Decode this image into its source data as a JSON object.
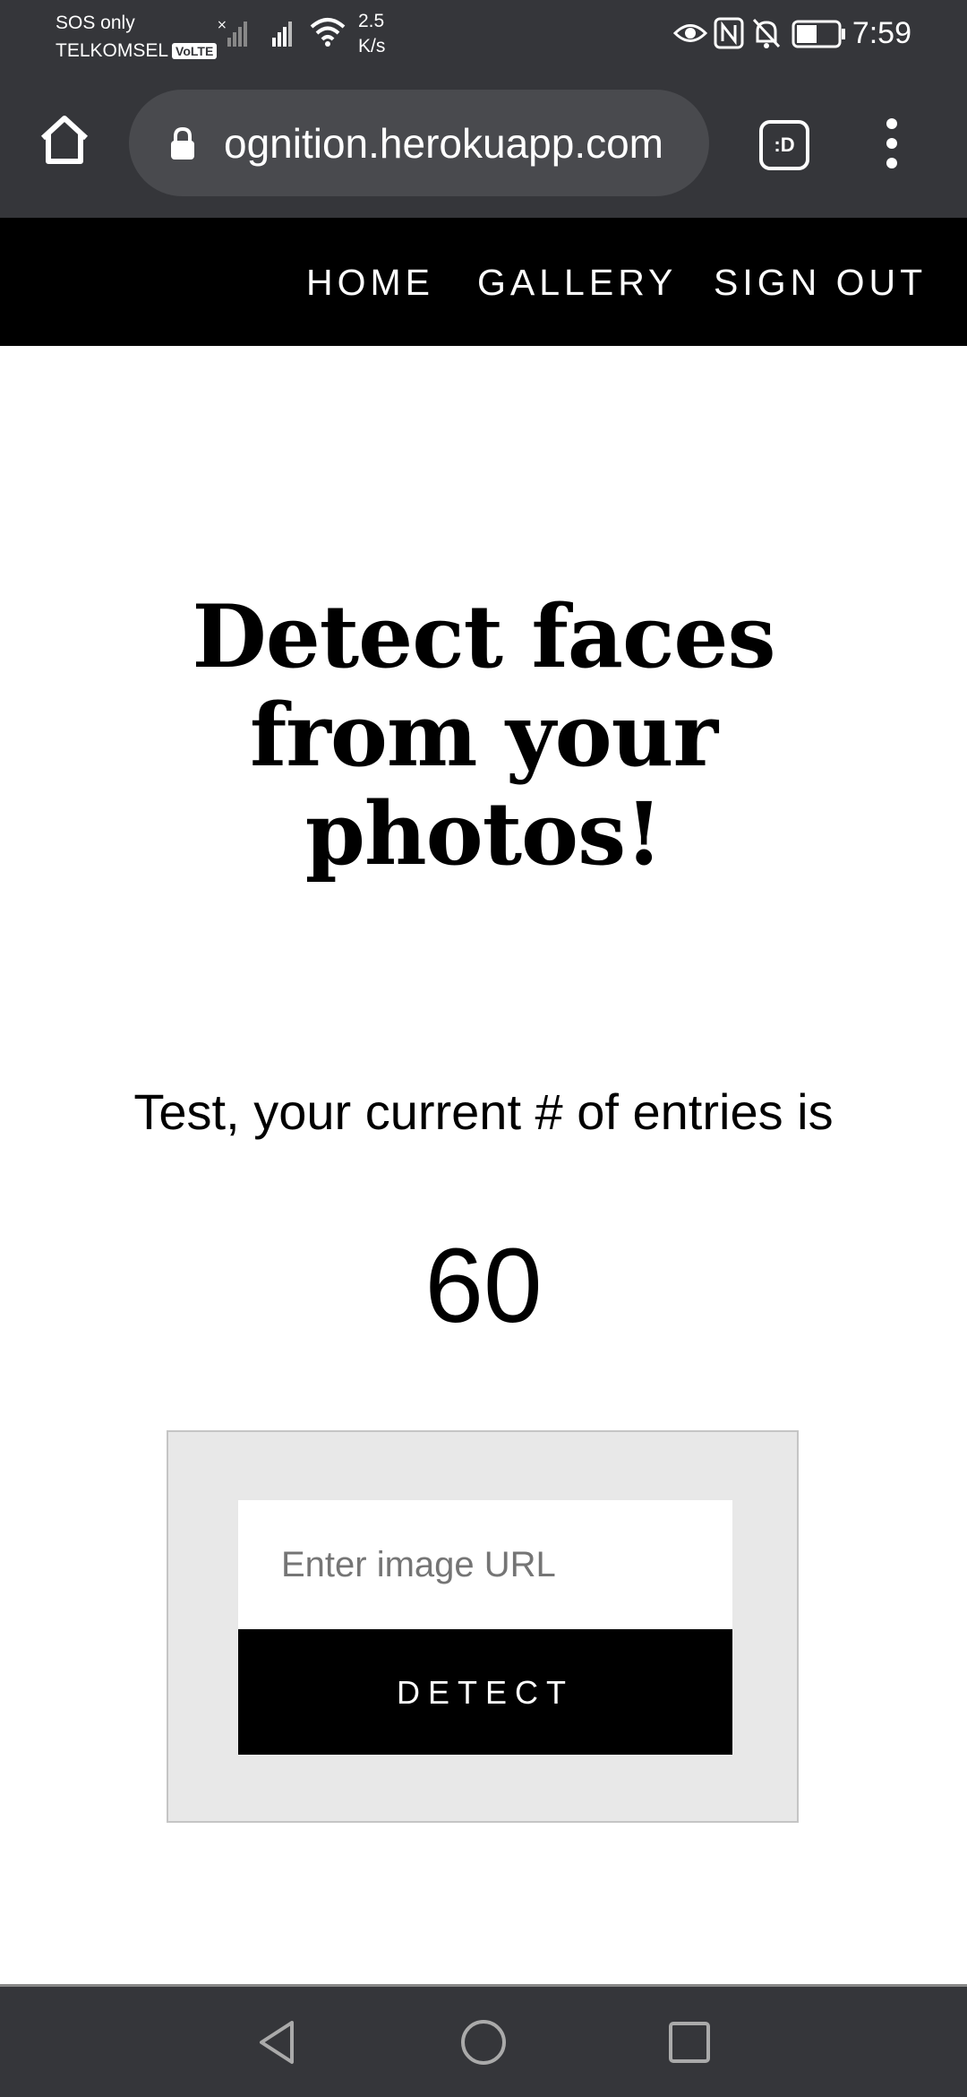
{
  "status_bar": {
    "carrier_line1": "SOS only",
    "carrier_line2": "TELKOMSEL",
    "volte": "VoLTE",
    "speed_value": "2.5",
    "speed_unit": "K/s",
    "time": "7:59",
    "icons": [
      "no-signal-icon",
      "signal-icon",
      "wifi-icon",
      "eye-icon",
      "nfc-icon",
      "bell-off-icon",
      "battery-icon"
    ]
  },
  "browser": {
    "url": "ognition.herokuapp.com",
    "tab_switcher_label": ":D",
    "icons": [
      "home-icon",
      "lock-icon",
      "more-vert-icon"
    ]
  },
  "nav": {
    "items": [
      "HOME",
      "GALLERY",
      "SIGN OUT"
    ]
  },
  "main": {
    "headline": "Detect faces from your photos!",
    "entries_text": "Test, your current # of entries is",
    "entries_count": "60"
  },
  "form": {
    "input_placeholder": "Enter image URL",
    "input_value": "",
    "button_label": "DETECT",
    "box_bg": "#e8e8e8"
  },
  "system_nav": {
    "icons": [
      "back-icon",
      "home-circle-icon",
      "recents-icon"
    ]
  },
  "colors": {
    "chrome_bar": "#35363a",
    "navbar": "#000000",
    "text": "#000000"
  }
}
